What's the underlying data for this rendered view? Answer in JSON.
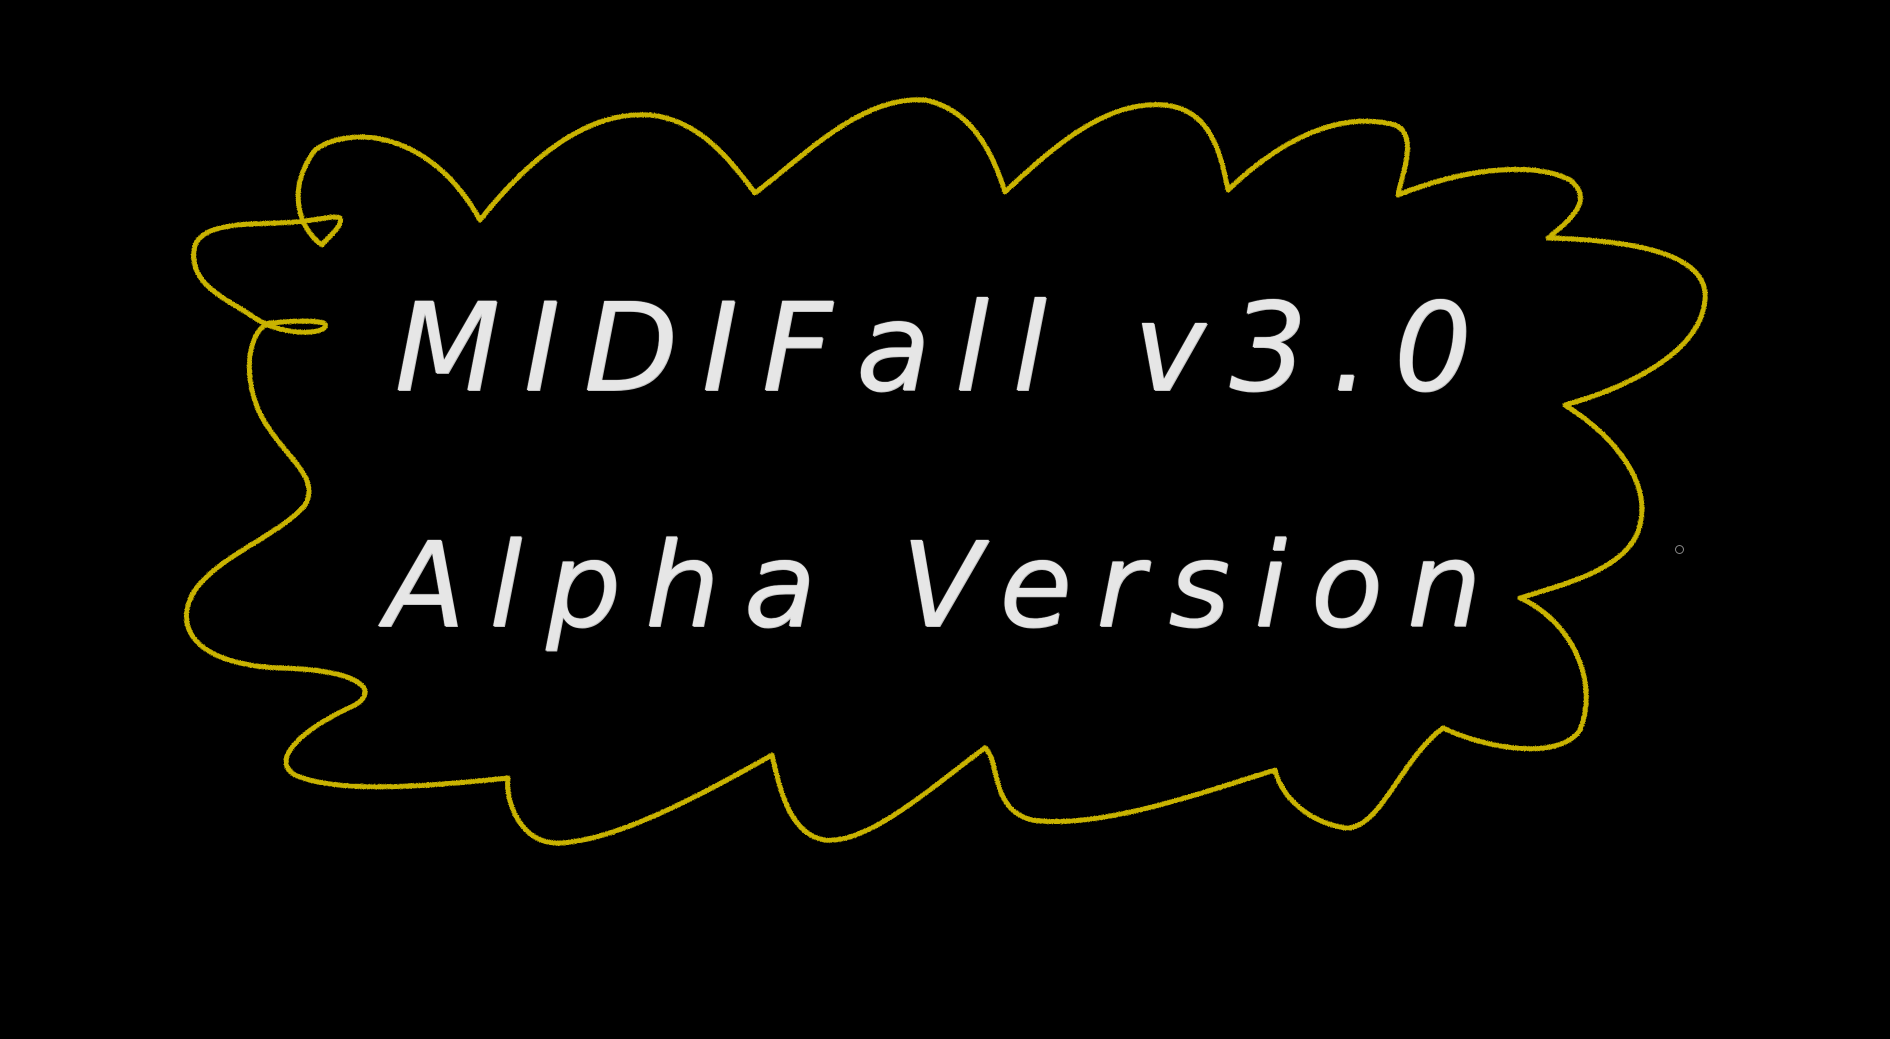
{
  "canvas": {
    "background_color": "#000000"
  },
  "splash": {
    "title": "MIDIFall v3.0",
    "subtitle": "Alpha Version",
    "text_color": "#e6e6e6",
    "outline_color": "#c9b300",
    "outline_shape": "scribbled-cloud-outline"
  },
  "cursor": {
    "icon": "cursor-ring-icon",
    "color": "#8a8a8a"
  }
}
